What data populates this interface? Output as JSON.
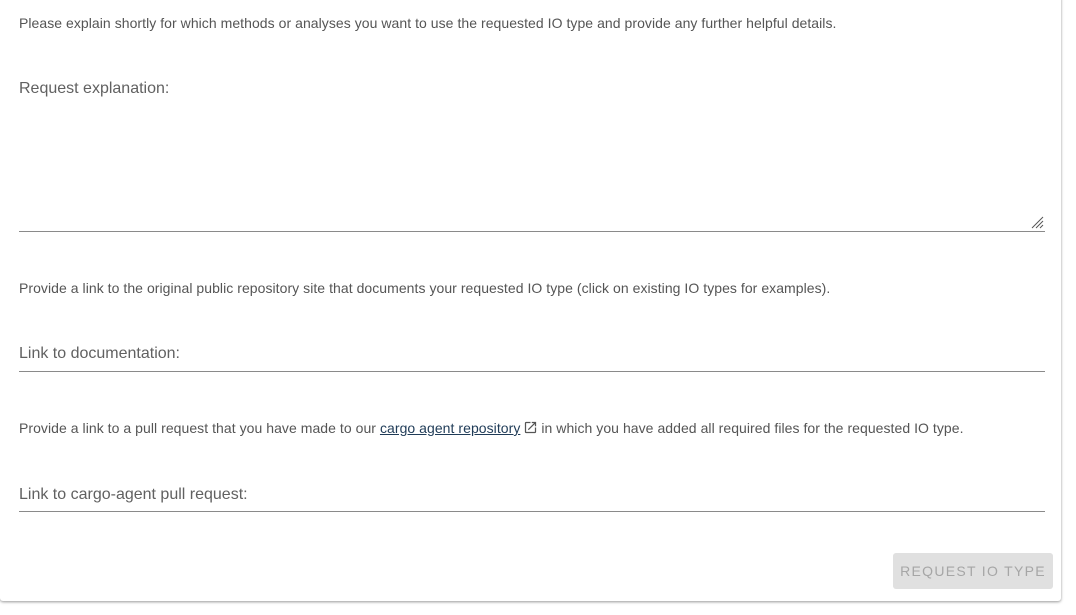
{
  "explanation_section": {
    "hint": "Please explain shortly for which methods or analyses you want to use the requested IO type and provide any further helpful details.",
    "label": "Request explanation:",
    "value": ""
  },
  "documentation_section": {
    "hint": "Provide a link to the original public repository site that documents your requested IO type (click on existing IO types for examples).",
    "label": "Link to documentation:",
    "value": ""
  },
  "pull_request_section": {
    "hint_before": "Provide a link to a pull request that you have made to our",
    "link_text": "cargo agent repository",
    "link_icon": "open-in-new-icon",
    "hint_after": "in which you have added all required files for the requested IO type.",
    "label": "Link to cargo-agent pull request:",
    "value": ""
  },
  "submit_button": {
    "label": "Request IO Type",
    "disabled": true
  },
  "colors": {
    "link": "#1f3b57",
    "hint_text": "#555555",
    "button_bg": "#e0e0e0",
    "button_text": "#a6a6a6"
  }
}
